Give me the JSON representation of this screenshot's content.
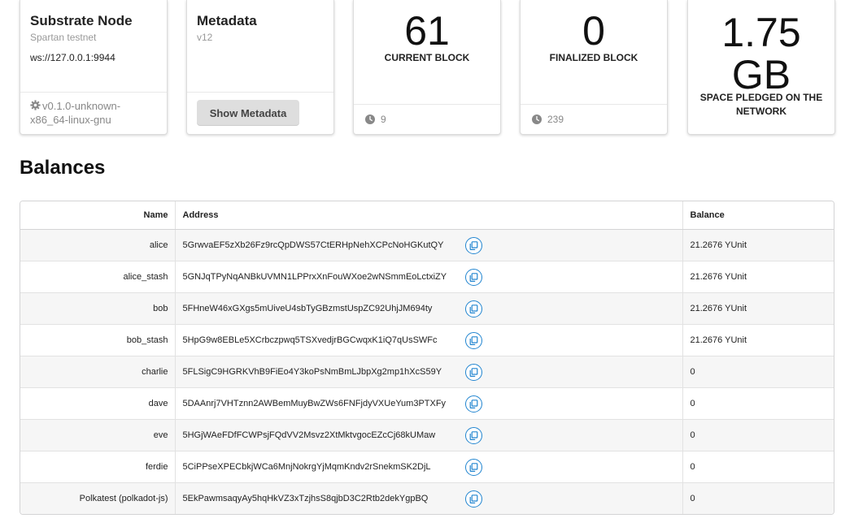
{
  "node_card": {
    "title": "Substrate Node",
    "subtitle": "Spartan testnet",
    "url": "ws://127.0.0.1:9944",
    "version": "v0.1.0-unknown-x86_64-linux-gnu",
    "version_icon": "gear-icon"
  },
  "metadata_card": {
    "title": "Metadata",
    "version": "v12",
    "button_label": "Show Metadata"
  },
  "current_block": {
    "value": "61",
    "label": "CURRENT BLOCK",
    "footer_value": "9",
    "footer_icon": "clock-icon"
  },
  "finalized_block": {
    "value": "0",
    "label": "FINALIZED BLOCK",
    "footer_value": "239",
    "footer_icon": "clock-icon"
  },
  "space_pledged": {
    "value": "1.75",
    "unit": "GB",
    "label": "SPACE PLEDGED ON THE NETWORK"
  },
  "balances": {
    "title": "Balances",
    "columns": [
      "Name",
      "Address",
      "Balance"
    ],
    "rows": [
      {
        "name": "alice",
        "address": "5GrwvaEF5zXb26Fz9rcQpDWS57CtERHpNehXCPcNoHGKutQY",
        "balance": "21.2676 YUnit"
      },
      {
        "name": "alice_stash",
        "address": "5GNJqTPyNqANBkUVMN1LPPrxXnFouWXoe2wNSmmEoLctxiZY",
        "balance": "21.2676 YUnit"
      },
      {
        "name": "bob",
        "address": "5FHneW46xGXgs5mUiveU4sbTyGBzmstUspZC92UhjJM694ty",
        "balance": "21.2676 YUnit"
      },
      {
        "name": "bob_stash",
        "address": "5HpG9w8EBLe5XCrbczpwq5TSXvedjrBGCwqxK1iQ7qUsSWFc",
        "balance": "21.2676 YUnit"
      },
      {
        "name": "charlie",
        "address": "5FLSigC9HGRKVhB9FiEo4Y3koPsNmBmLJbpXg2mp1hXcS59Y",
        "balance": "0"
      },
      {
        "name": "dave",
        "address": "5DAAnrj7VHTznn2AWBemMuyBwZWs6FNFjdyVXUeYum3PTXFy",
        "balance": "0"
      },
      {
        "name": "eve",
        "address": "5HGjWAeFDfFCWPsjFQdVV2Msvz2XtMktvgocEZcCj68kUMaw",
        "balance": "0"
      },
      {
        "name": "ferdie",
        "address": "5CiPPseXPECbkjWCa6MnjNokrgYjMqmKndv2rSnekmSK2DjL",
        "balance": "0"
      },
      {
        "name": "Polkatest (polkadot-js)",
        "address": "5EkPawmsaqyAy5hqHkVZ3xTzjhsS8qjbD3C2Rtb2dekYgpBQ",
        "balance": "0"
      }
    ],
    "copy_icon": "copy-icon"
  },
  "colors": {
    "accent": "#2185d0",
    "muted_text": "#888888",
    "button_bg": "#dedede"
  }
}
